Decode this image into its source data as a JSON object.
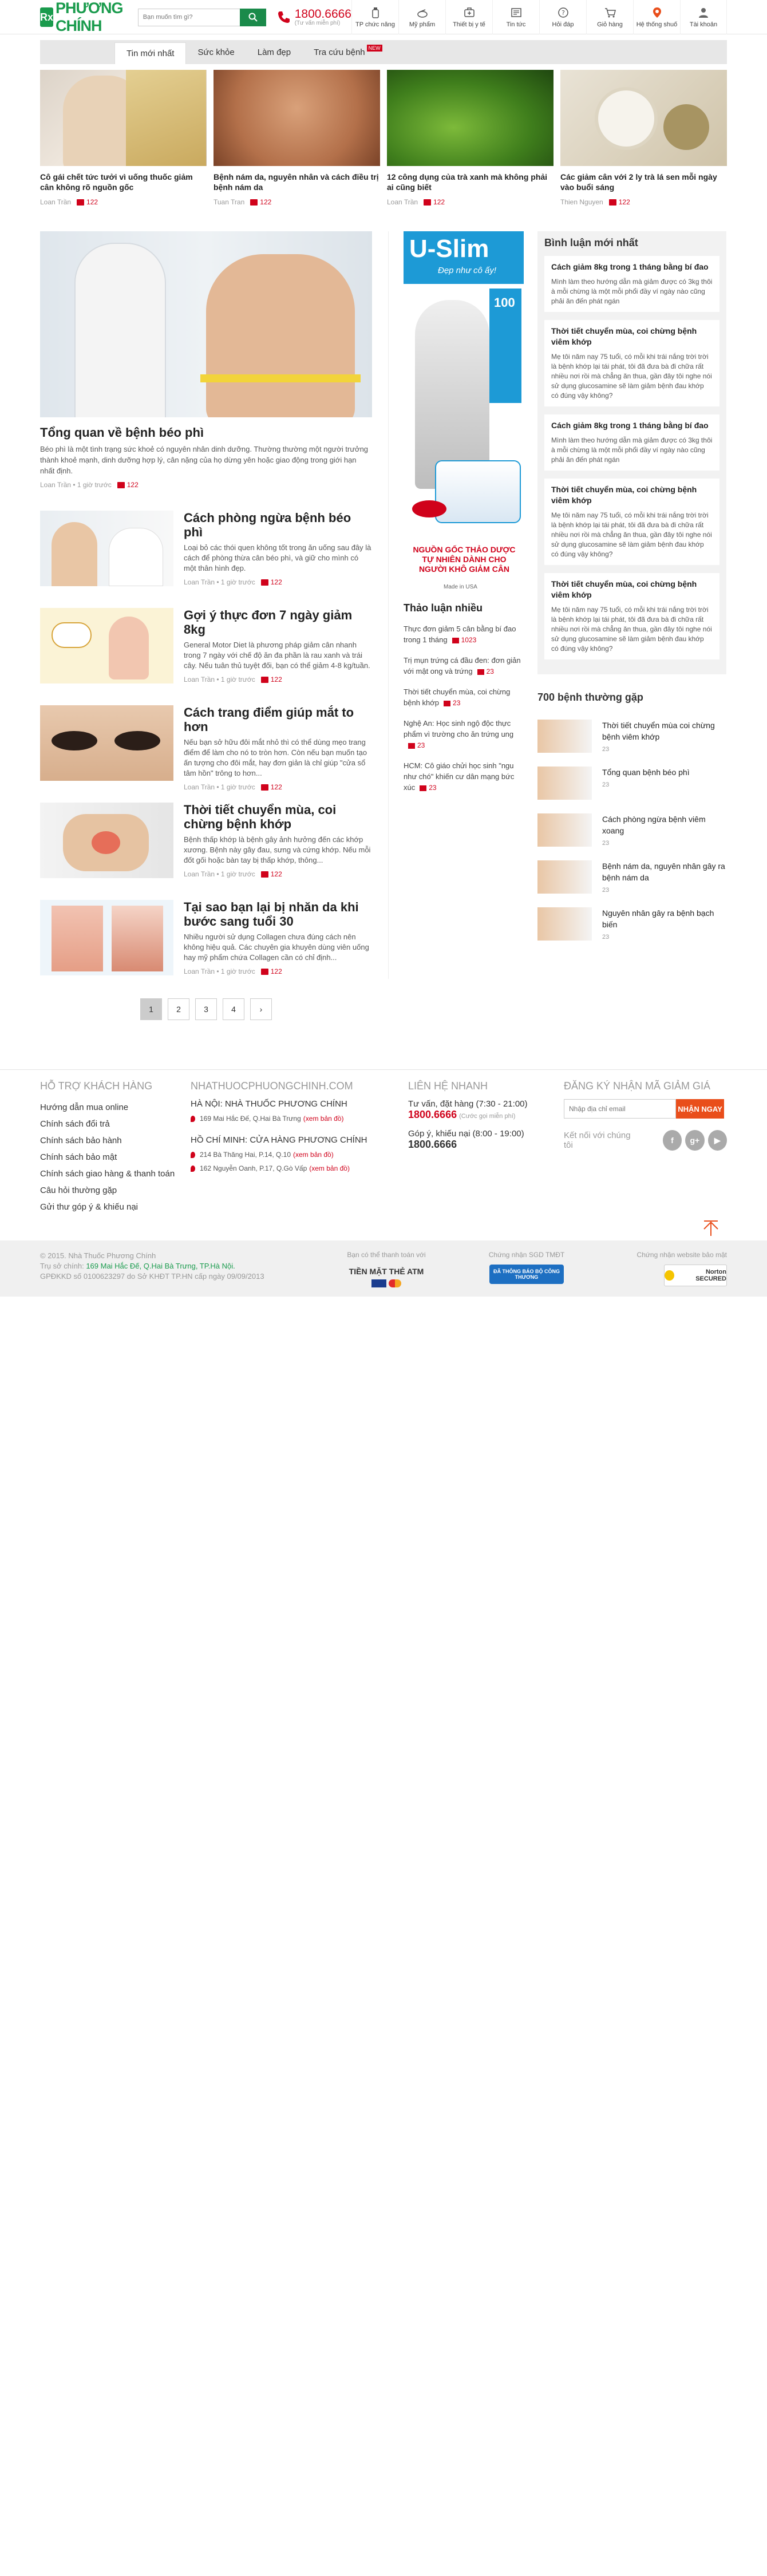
{
  "header": {
    "logo": "PHƯƠNG CHÍNH",
    "logo_mark": "Rx",
    "search_placeholder": "Bạn muốn tìm gì?",
    "hotline": "1800.6666",
    "hotline_sub": "(Tư vấn miễn phí)",
    "nav": [
      {
        "label": "TP chức năng",
        "icon": "bottle-icon"
      },
      {
        "label": "Mỹ phẩm",
        "icon": "cosmetic-icon"
      },
      {
        "label": "Thiết bị y tế",
        "icon": "device-icon"
      },
      {
        "label": "Tin tức",
        "icon": "news-icon"
      },
      {
        "label": "Hỏi đáp",
        "icon": "question-icon"
      },
      {
        "label": "Giỏ hàng",
        "icon": "cart-icon"
      },
      {
        "label": "Hệ thống shuố",
        "icon": "location-icon"
      },
      {
        "label": "Tài khoản",
        "icon": "user-icon"
      }
    ]
  },
  "tabs": [
    {
      "label": "Tin mới nhất",
      "active": true
    },
    {
      "label": "Sức khỏe"
    },
    {
      "label": "Làm đẹp"
    },
    {
      "label": "Tra cứu bệnh",
      "badge": "NEW"
    }
  ],
  "featured": [
    {
      "title": "Cô gái chết tức tưởi vì uống thuốc giảm cân không rõ nguồn gốc",
      "author": "Loan Trần",
      "time": "",
      "comments": "122"
    },
    {
      "title": "Bệnh nám da, nguyên nhân và cách điều trị bệnh nám da",
      "author": "Tuan Tran",
      "time": "",
      "comments": "122"
    },
    {
      "title": "12 công dụng của trà xanh mà không phải ai cũng biết",
      "author": "Loan Trần",
      "time": "",
      "comments": "122"
    },
    {
      "title": "Các giảm cân với 2 ly trà lá sen mỗi ngày vào buổi sáng",
      "author": "Thien Nguyen",
      "time": "",
      "comments": "122"
    }
  ],
  "main_feature": {
    "title": "Tổng quan về bệnh béo phì",
    "summary": "Béo phì là một tình trạng sức khoẻ có nguyên nhân dinh dưỡng. Thường thường một người trưởng thành khoẻ mạnh, dinh dưỡng hợp lý, cân nặng của họ dừng yên hoặc giao động trong giới hạn nhất định.",
    "author": "Loan Trần",
    "time": "1 giờ trước",
    "comments": "122"
  },
  "articles": [
    {
      "title": "Cách phòng ngừa bệnh béo phì",
      "summary": "Loại bỏ các thói quen không tốt trong ăn uống sau đây là cách để phòng thừa cân béo phì, và giữ cho mình có một thân hình đẹp.",
      "author": "Loan Trần",
      "time": "1 giờ trước",
      "comments": "122"
    },
    {
      "title": "Gợi ý thực đơn 7 ngày giảm 8kg",
      "summary": "General Motor Diet là phương pháp giảm cân nhanh trong 7 ngày với chế độ ăn đa phần là rau xanh và trái cây. Nếu tuân thủ tuyệt đối, bạn có thể giảm 4-8 kg/tuần.",
      "author": "Loan Trần",
      "time": "1 giờ trước",
      "comments": "122"
    },
    {
      "title": "Cách trang điểm giúp mắt to hơn",
      "summary": "Nếu bạn sở hữu đôi mắt nhỏ thì có thể dùng mẹo trang điểm để làm cho nó to tròn hơn. Còn nếu bạn muốn tạo ấn tượng cho đôi mắt, hay đơn giản là chỉ giúp \"cửa sổ tâm hồn\" trông to hơn...",
      "author": "Loan Trần",
      "time": "1 giờ trước",
      "comments": "122"
    },
    {
      "title": "Thời tiết chuyển mùa, coi chừng bệnh khớp",
      "summary": "Bệnh thấp khớp là bệnh gây ảnh hưởng đến các khớp xương. Bệnh này gây đau, sưng và cứng khớp. Nếu mỗi đốt gối hoặc bàn tay bị thấp khớp, thông...",
      "author": "Loan Trần",
      "time": "1 giờ trước",
      "comments": "122"
    },
    {
      "title": "Tại sao bạn lại bị nhăn da khi bước sang tuổi 30",
      "summary": "Nhiều người sử dụng Collagen chưa đúng cách nên không hiệu quả. Các chuyên gia khuyên dùng viên uống hay mỹ phẩm chứa Collagen cần có chỉ định...",
      "author": "Loan Trần",
      "time": "1 giờ trước",
      "comments": "122"
    }
  ],
  "pagination": {
    "pages": [
      "1",
      "2",
      "3",
      "4"
    ],
    "current": "1",
    "next": "›"
  },
  "banner": {
    "brand": "U-Slim",
    "slogan": "Đẹp như cô ấy!",
    "badge": "100",
    "headline": "NGUỒN GỐC THẢO DƯỢC TỰ NHIÊN DÀNH CHO NGƯỜI KHÔ GIẢM CÂN",
    "origin": "Made in USA"
  },
  "hot_topics": {
    "title": "Thảo luận nhiều",
    "items": [
      {
        "text": "Thực đơn giảm 5 cân bằng bí đao trong 1 tháng",
        "comments": "1023"
      },
      {
        "text": "Trị mụn trứng cá đầu đen: đơn giản với mật ong và trứng",
        "comments": "23"
      },
      {
        "text": "Thời tiết chuyển mùa, coi chừng bệnh khớp",
        "comments": "23"
      },
      {
        "text": "Nghệ An: Học sinh ngộ độc thực phẩm vì trường cho ăn trứng ung",
        "comments": "23"
      },
      {
        "text": "HCM: Cô giáo chửi học sinh \"ngu như chó\" khiến cư dân mạng bức xúc",
        "comments": "23"
      }
    ]
  },
  "recent_comments": {
    "title": "Bình luận mới nhất",
    "items": [
      {
        "title": "Cách giảm 8kg trong 1 tháng bằng bí đao",
        "text": "Mình làm theo hướng dẫn mà giảm được có 3kg thôi à mỗi chừng là một mỗi phổi đầy ví ngày nào cũng phải ăn đến phát ngán"
      },
      {
        "title": "Thời tiết chuyển mùa, coi chừng bệnh viêm khớp",
        "text": "Mẹ tôi năm nay 75 tuổi, có mỗi khi trái nắng trời trời là bệnh khớp lại tái phát, tôi đã đưa bà đi chữa rất nhiều nơi rồi mà chẳng ăn thua, gần đây tôi nghe nói sử dụng glucosamine sẽ làm giảm bệnh đau khớp có đúng vậy không?"
      },
      {
        "title": "Cách giảm 8kg trong 1 tháng bằng bí đao",
        "text": "Mình làm theo hướng dẫn mà giảm được có 3kg thôi à mỗi chừng là một mỗi phổi đầy ví ngày nào cũng phải ăn đến phát ngán"
      },
      {
        "title": "Thời tiết chuyển mùa, coi chừng bệnh viêm khớp",
        "text": "Mẹ tôi năm nay 75 tuổi, có mỗi khi trái nắng trời trời là bệnh khớp lại tái phát, tôi đã đưa bà đi chữa rất nhiều nơi rồi mà chẳng ăn thua, gần đây tôi nghe nói sử dụng glucosamine sẽ làm giảm bệnh đau khớp có đúng vậy không?"
      },
      {
        "title": "Thời tiết chuyển mùa, coi chừng bệnh viêm khớp",
        "text": "Mẹ tôi năm nay 75 tuổi, có mỗi khi trái nắng trời trời là bệnh khớp lại tái phát, tôi đã đưa bà đi chữa rất nhiều nơi rồi mà chẳng ăn thua, gần đây tôi nghe nói sử dụng glucosamine sẽ làm giảm bệnh đau khớp có đúng vậy không?"
      }
    ]
  },
  "diseases": {
    "title": "700 bệnh thường gặp",
    "items": [
      {
        "text": "Thời tiết chuyển mùa coi chừng bệnh viêm khớp",
        "meta": "23"
      },
      {
        "text": "Tổng quan bệnh béo phì",
        "meta": "23"
      },
      {
        "text": "Cách phòng ngừa bệnh viêm xoang",
        "meta": "23"
      },
      {
        "text": "Bệnh nám da, nguyên nhân gây ra bệnh nám da",
        "meta": "23"
      },
      {
        "text": "Nguyên nhân gây ra bệnh bạch biến",
        "meta": "23"
      }
    ]
  },
  "footer": {
    "support": {
      "title": "HỖ TRỢ KHÁCH HÀNG",
      "links": [
        "Hướng dẫn mua online",
        "Chính sách đổi trả",
        "Chính sách bảo hành",
        "Chính sách bảo mật",
        "Chính sách giao hàng & thanh toán",
        "Câu hỏi thường gặp",
        "Gửi thư góp ý & khiếu nại"
      ]
    },
    "stores": {
      "title": "NHATHUOCPHUONGCHINH.COM",
      "hn_title": "HÀ NỘI: NHÀ THUỐC PHƯƠNG CHÍNH",
      "hn_addr": "169 Mai Hắc Đế, Q.Hai Bà Trưng",
      "hcm_title": "HỒ CHÍ MINH: CỬA HÀNG PHƯƠNG CHÍNH",
      "hcm_addr1": "214 Bà Thăng Hai, P.14, Q.10",
      "hcm_addr2": "162 Nguyễn Oanh, P.17, Q.Gò Vấp",
      "map_link": "(xem bản đồ)"
    },
    "contact": {
      "title": "LIÊN HỆ NHANH",
      "consult": "Tư vấn, đặt hàng (7:30 - 21:00)",
      "consult_num": "1800.6666",
      "consult_note": "(Cước gọi miễn phí)",
      "complain": "Góp ý, khiếu nại (8:00 - 19:00)",
      "complain_num": "1800.6666"
    },
    "newsletter": {
      "title": "ĐĂNG KÝ NHẬN MÃ GIẢM GIÁ",
      "placeholder": "Nhập địa chỉ email",
      "button": "NHẬN NGAY",
      "social_label": "Kết nối với chúng tôi"
    }
  },
  "bottom": {
    "copyright": "© 2015. Nhà Thuốc Phương Chính",
    "hq_label": "Trụ sở chính:",
    "hq_addr": "169 Mai Hắc Đế, Q.Hai Bà Trưng, TP.Hà Nội.",
    "license": "GPĐKKD số 0100623297 do Sở KHĐT TP.HN cấp ngày 09/09/2013",
    "pay_title": "Bạn có thể thanh toán với",
    "pay_methods": "TIỀN MẶT  THẺ ATM",
    "cert1_title": "Chứng nhận SGD TMĐT",
    "cert1_badge": "ĐÃ THÔNG BÁO BỘ CÔNG THƯƠNG",
    "cert2_title": "Chứng nhận website bảo mật",
    "cert2_badge": "Norton SECURED"
  },
  "colors": {
    "brand": "#1a9b4d",
    "accent": "#d0021b",
    "cta": "#e94e1b"
  }
}
